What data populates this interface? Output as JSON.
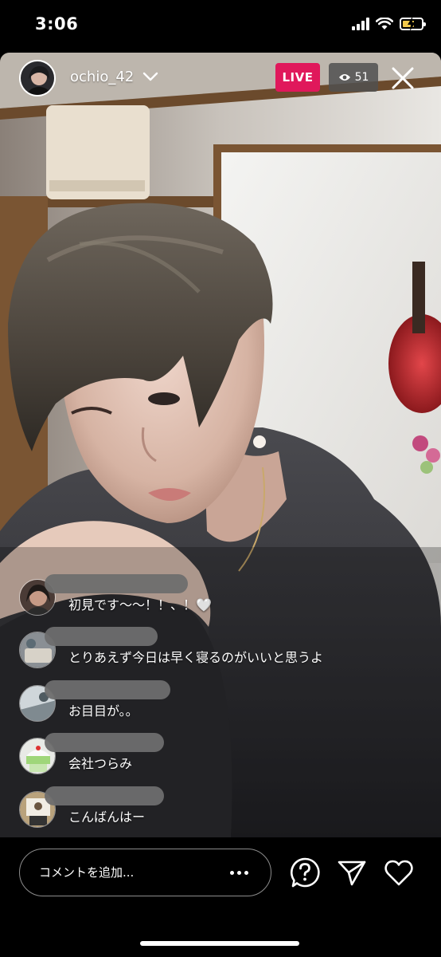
{
  "status_bar": {
    "time": "3:06"
  },
  "header": {
    "host_name": "ochio_42",
    "live_label": "LIVE",
    "viewer_count": "51"
  },
  "comments": [
    {
      "text": "初見です〜〜！！、！🤍"
    },
    {
      "text": "とりあえず今日は早く寝るのがいいと思うよ"
    },
    {
      "text": "お目目が。。"
    },
    {
      "text": "会社つらみ"
    },
    {
      "text": "こんばんはー"
    }
  ],
  "composer": {
    "placeholder": "コメントを追加..."
  },
  "colors": {
    "live": "#e0185b",
    "battery": "#f2c94c"
  },
  "icons": [
    "wifi-icon",
    "signal-icon",
    "battery-icon",
    "eye-icon",
    "close-icon",
    "chevron-down-icon",
    "more-icon",
    "question-icon",
    "send-icon",
    "heart-icon"
  ]
}
